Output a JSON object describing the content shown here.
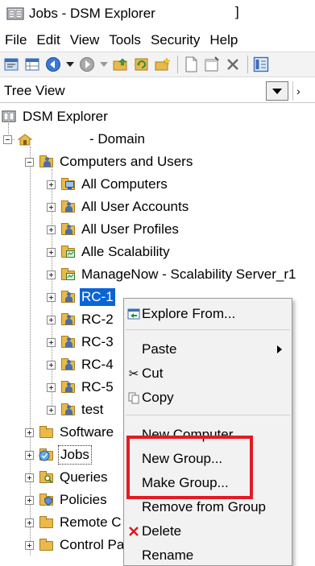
{
  "window": {
    "title": "Jobs - DSM Explorer",
    "title_suffix": "]"
  },
  "menubar": {
    "items": [
      "File",
      "Edit",
      "View",
      "Tools",
      "Security",
      "Help"
    ]
  },
  "toolbar": {
    "buttons": [
      "properties-icon",
      "grid-icon",
      "back-icon",
      "dropdown-icon",
      "forward-icon",
      "dropdown-icon",
      "folder-up-icon",
      "refresh-icon",
      "new-folder-icon",
      "new-item-icon",
      "properties-page-icon",
      "close-icon",
      "view-icon"
    ]
  },
  "treeview": {
    "label": "Tree View",
    "scroll_label": "›"
  },
  "tree": {
    "root": "DSM Explorer",
    "domain": "- Domain",
    "computers_and_users": "Computers and Users",
    "children": [
      {
        "label": "All Computers",
        "icon": "computers-folder-icon"
      },
      {
        "label": "All User Accounts",
        "icon": "users-folder-icon"
      },
      {
        "label": "All User Profiles",
        "icon": "profiles-folder-icon"
      },
      {
        "label": "Alle Scalability",
        "icon": "scalability-folder-icon"
      },
      {
        "label": "ManageNow - Scalability Server_r1",
        "icon": "scalability-folder-icon"
      },
      {
        "label": "RC-1",
        "icon": "group-folder-icon",
        "selected": true
      },
      {
        "label": "RC-2",
        "icon": "group-folder-icon"
      },
      {
        "label": "RC-3",
        "icon": "group-folder-icon"
      },
      {
        "label": "RC-4",
        "icon": "group-folder-icon"
      },
      {
        "label": "RC-5",
        "icon": "group-folder-icon"
      },
      {
        "label": "test",
        "icon": "group-folder-icon"
      }
    ],
    "top_level": [
      {
        "label": "Software",
        "icon": "software-folder-icon"
      },
      {
        "label": "Jobs",
        "icon": "jobs-folder-icon"
      },
      {
        "label": "Queries",
        "icon": "queries-folder-icon"
      },
      {
        "label": "Policies",
        "icon": "policies-folder-icon"
      },
      {
        "label": "Remote C",
        "icon": "remote-folder-icon"
      },
      {
        "label": "Control Pa",
        "icon": "control-panel-folder-icon"
      }
    ]
  },
  "context_menu": {
    "explore_from": "Explore From...",
    "paste": "Paste",
    "cut": "Cut",
    "copy": "Copy",
    "new_computer": "New Computer",
    "new_group": "New Group...",
    "make_group": "Make Group...",
    "remove_from_group": "Remove from Group",
    "delete": "Delete",
    "rename": "Rename"
  },
  "colors": {
    "selection": "#0a64d6",
    "highlight_box": "#e31b23",
    "folder": "#e9b94a"
  }
}
